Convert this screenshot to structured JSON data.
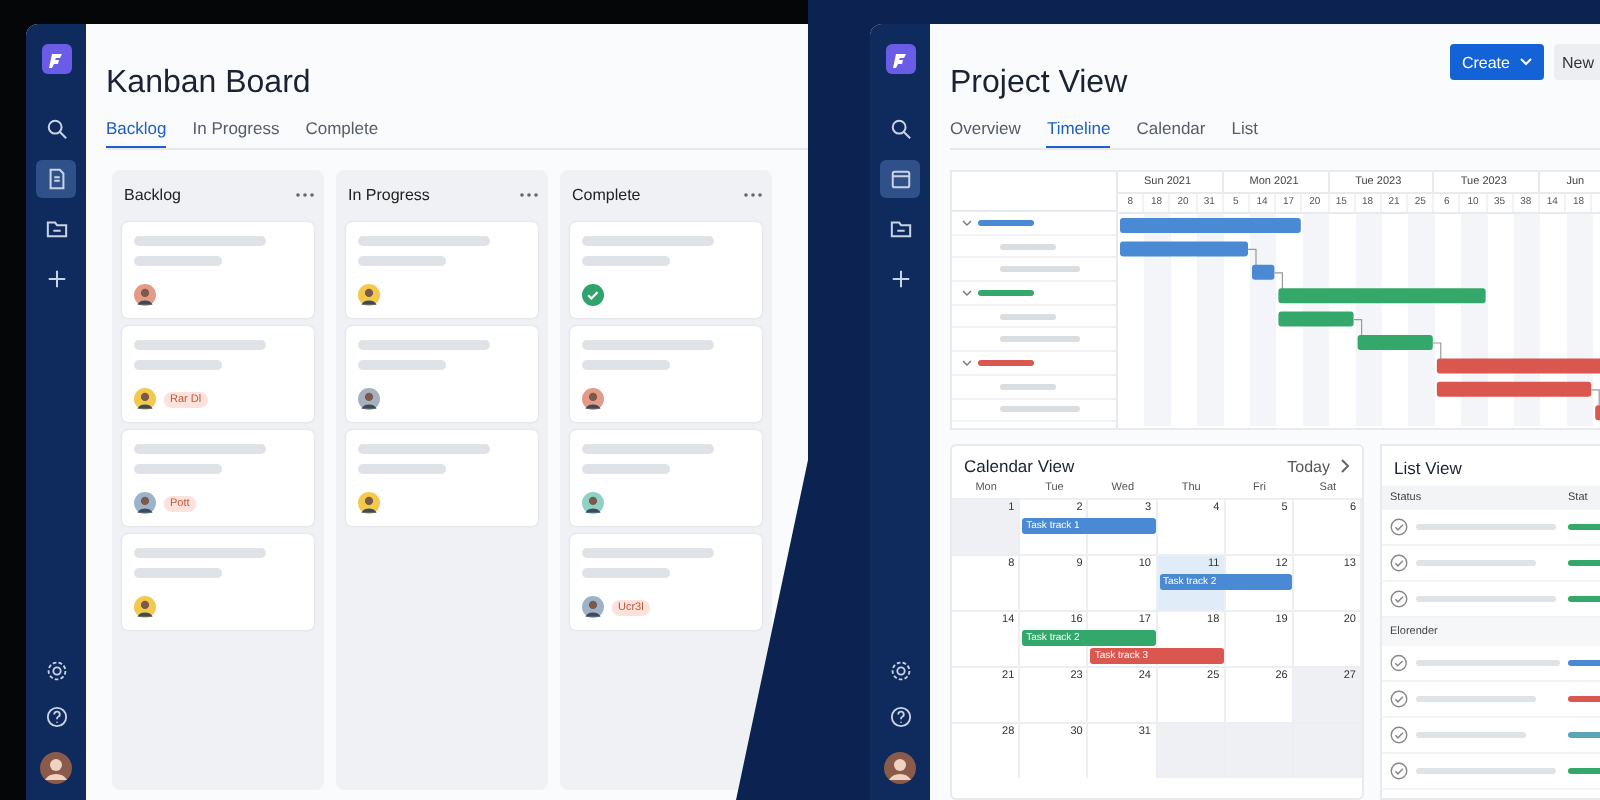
{
  "kanban": {
    "sidebar": [
      {
        "kind": "logo"
      },
      {
        "kind": "search",
        "selected": false
      },
      {
        "kind": "document",
        "selected": true
      },
      {
        "kind": "folder",
        "selected": false
      },
      {
        "kind": "plus",
        "selected": false
      }
    ],
    "sidebar_bottom": [
      {
        "kind": "settings"
      },
      {
        "kind": "help"
      },
      {
        "kind": "avatar",
        "color": "#8a5a4a"
      }
    ],
    "title": "Kanban Board",
    "tabs": [
      {
        "label": "Backlog",
        "selected": true
      },
      {
        "label": "In Progress",
        "selected": false
      },
      {
        "label": "Complete",
        "selected": false
      }
    ],
    "columns": [
      {
        "title": "Backlog",
        "cards": [
          {
            "kind": "avatar",
            "color": "#e39a86"
          },
          {
            "kind": "avatar",
            "color": "#f2c94c",
            "tag": "Rar Dl"
          },
          {
            "kind": "avatar",
            "color": "#9fb3c8",
            "tag": "Pott"
          },
          {
            "kind": "avatar",
            "color": "#f2c94c"
          }
        ]
      },
      {
        "title": "In Progress",
        "cards": [
          {
            "kind": "avatar",
            "color": "#f2c94c"
          },
          {
            "kind": "avatar",
            "color": "#a7b0bc"
          },
          {
            "kind": "avatar",
            "color": "#f2c94c"
          }
        ]
      },
      {
        "title": "Complete",
        "cards": [
          {
            "kind": "check",
            "color": "#2fa36b"
          },
          {
            "kind": "avatar",
            "color": "#e39a86"
          },
          {
            "kind": "avatar",
            "color": "#8fd1c4"
          },
          {
            "kind": "avatar",
            "color": "#9fb3c8",
            "tag": "Ucr3l"
          }
        ]
      }
    ]
  },
  "project": {
    "sidebar": [
      {
        "kind": "logo"
      },
      {
        "kind": "search",
        "selected": false
      },
      {
        "kind": "calendar",
        "selected": true
      },
      {
        "kind": "folder",
        "selected": false
      },
      {
        "kind": "plus",
        "selected": false
      }
    ],
    "sidebar_bottom": [
      {
        "kind": "settings"
      },
      {
        "kind": "help"
      },
      {
        "kind": "avatar",
        "color": "#8a5a4a"
      }
    ],
    "title": "Project View",
    "create_button": "Create",
    "new_button": "New",
    "tabs": [
      {
        "label": "Overview",
        "selected": false
      },
      {
        "label": "Timeline",
        "selected": true
      },
      {
        "label": "Calendar",
        "selected": false
      },
      {
        "label": "List",
        "selected": false
      }
    ],
    "gantt": {
      "months": [
        "Sun 2021",
        "Mon 2021",
        "Tue 2023",
        "Tue 2023",
        "Jun"
      ],
      "days": [
        "8",
        "18",
        "20",
        "31",
        "5",
        "14",
        "17",
        "20",
        "15",
        "18",
        "21",
        "25",
        "6",
        "10",
        "35",
        "38",
        "14",
        "18"
      ],
      "rows": [
        {
          "kind": "group",
          "color": "#4a8ad4"
        },
        {
          "kind": "task",
          "color": "#4a8ad4"
        },
        {
          "kind": "task",
          "color": "#4a8ad4"
        },
        {
          "kind": "group",
          "color": "#34a86a"
        },
        {
          "kind": "task",
          "color": "#34a86a"
        },
        {
          "kind": "task",
          "color": "#34a86a"
        },
        {
          "kind": "group",
          "color": "#d9574f"
        },
        {
          "kind": "task",
          "color": "#d9574f"
        },
        {
          "kind": "task",
          "color": "#d9574f"
        }
      ]
    },
    "calendar": {
      "title": "Calendar View",
      "today": "Today",
      "weekdays": [
        "Mon",
        "Tue",
        "Wed",
        "Thu",
        "Fri",
        "Sat"
      ],
      "weeks": [
        [
          {
            "number": "1",
            "shaded": true
          },
          {
            "number": "2",
            "shaded": false,
            "events": [
              {
                "label": "Task track 1",
                "color": "#4a8ad4"
              }
            ]
          },
          {
            "number": "3",
            "shaded": false
          },
          {
            "number": "4",
            "shaded": false
          },
          {
            "number": "5",
            "shaded": false
          },
          {
            "number": "6",
            "shaded": false
          }
        ],
        [
          {
            "number": "8",
            "shaded": false
          },
          {
            "number": "9",
            "shaded": false
          },
          {
            "number": "10",
            "shaded": false
          },
          {
            "number": "11",
            "shaded": false,
            "highlighted": true,
            "events": [
              {
                "label": "Task track 2",
                "color": "#4a8ad4"
              }
            ]
          },
          {
            "number": "12",
            "shaded": false
          },
          {
            "number": "13",
            "shaded": false
          }
        ],
        [
          {
            "number": "14",
            "shaded": false
          },
          {
            "number": "16",
            "shaded": false,
            "events": [
              {
                "label": "Task track 2",
                "color": "#34a86a"
              }
            ]
          },
          {
            "number": "17",
            "shaded": false,
            "events": [
              {
                "label": "Task track 3",
                "color": "#d9574f"
              }
            ]
          },
          {
            "number": "18",
            "shaded": false
          },
          {
            "number": "19",
            "shaded": false
          },
          {
            "number": "20",
            "shaded": false
          }
        ],
        [
          {
            "number": "21",
            "shaded": false
          },
          {
            "number": "23",
            "shaded": false
          },
          {
            "number": "24",
            "shaded": false
          },
          {
            "number": "25",
            "shaded": false
          },
          {
            "number": "26",
            "shaded": false
          },
          {
            "number": "27",
            "shaded": true
          }
        ],
        [
          {
            "number": "28",
            "shaded": false
          },
          {
            "number": "30",
            "shaded": false
          },
          {
            "number": "31",
            "shaded": false
          },
          {
            "shaded": true
          },
          {
            "shaded": true
          },
          {
            "shaded": true
          }
        ]
      ]
    },
    "list": {
      "title": "List View",
      "columns": [
        "Status",
        "Stat"
      ],
      "rows": [
        {
          "kind": "item",
          "color": "#34a86a"
        },
        {
          "kind": "item",
          "color": "#34a86a"
        },
        {
          "kind": "item",
          "color": "#34a86a"
        },
        {
          "kind": "section",
          "label": "Elorender"
        },
        {
          "kind": "item",
          "color": "#4a8ad4"
        },
        {
          "kind": "item",
          "color": "#d9574f"
        },
        {
          "kind": "item",
          "color": "#5aa5b8"
        },
        {
          "kind": "item",
          "color": "#34a86a"
        }
      ]
    }
  }
}
